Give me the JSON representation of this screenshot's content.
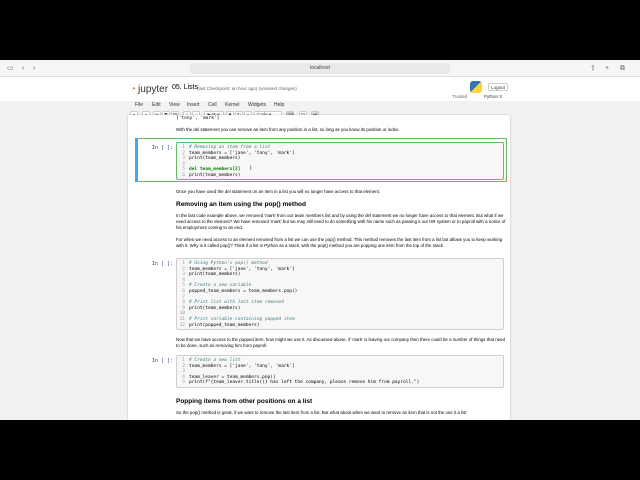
{
  "browser": {
    "url": "localhost"
  },
  "header": {
    "logo": "jupyter",
    "title": "05. Lists",
    "checkpoint": "(last Checkpoint: an hour ago)   (unsaved changes)",
    "logout": "Logout",
    "trusted": "Trusted",
    "kernel": "Python 3"
  },
  "menu": [
    "File",
    "Edit",
    "View",
    "Insert",
    "Cell",
    "Kernel",
    "Widgets",
    "Help"
  ],
  "toolbar": {
    "run": "Run",
    "cell_type": "Code"
  },
  "notebook": {
    "prev_output": "['tony', 'mark']",
    "p1": "With the del statement you can remove an item from any position in a list, so long as you know its position or index.",
    "cell1_prompt": "In [ ]:",
    "cell1": [
      "# Removing an item from a list",
      "team_members = ['jane', 'tony', 'mark']",
      "print(team_members)",
      "",
      "del team_members[2]",
      "print(team_members)"
    ],
    "p2": "Once you have used the del statement on an item in a list you will no longer have access to that element.",
    "h1": "Removing an item using the pop() method",
    "p3": "In the last code example above, we removed 'mark' from our team members list and by using the del statement we no longer have access to that element. But what if we need access to the element? We have removed 'mark' but we may still need to do something with his name such as passing it our HR system or to payroll with a notice of his employment coming to an end.",
    "p4": "For when we need access to an element removed from a list we can use the pop() method. This method removes the last item from a list but allows you to keep working with it. Why is it called pop()? Think if a list in Python as a stack, with the pop() method you are popping one item from the top of the stack.",
    "cell2_prompt": "In [ ]:",
    "cell2": [
      "# Using Python's pop() method",
      "team_members = ['jane', 'tony', 'mark']",
      "print(team_members)",
      "",
      "# Create a new variable",
      "popped_team_members = team_members.pop()",
      "",
      "# Print list with last item removed",
      "print(team_members)",
      "",
      "# Print variable containing popped item",
      "print(popped_team_members)"
    ],
    "p5": "Now that we have access to the popped item, how might we use it. As discussed above, if 'mark' is leaving our company then there could be a number of things that need to be done, such as removing him from payroll.",
    "cell3_prompt": "In [ ]:",
    "cell3": [
      "# Create a new list",
      "team_members = ['jane', 'tony', 'mark']",
      "",
      "team_leaver = team_members.pop()",
      "print(f\"{team_leaver.title()} has left the company, please remove him from payroll.\")"
    ],
    "h2": "Popping items from other positions on a list",
    "p6": "So the pop() method is great, if we want to remove the last item from a list. But what about when we want to remove an item that is not the one it a list"
  }
}
